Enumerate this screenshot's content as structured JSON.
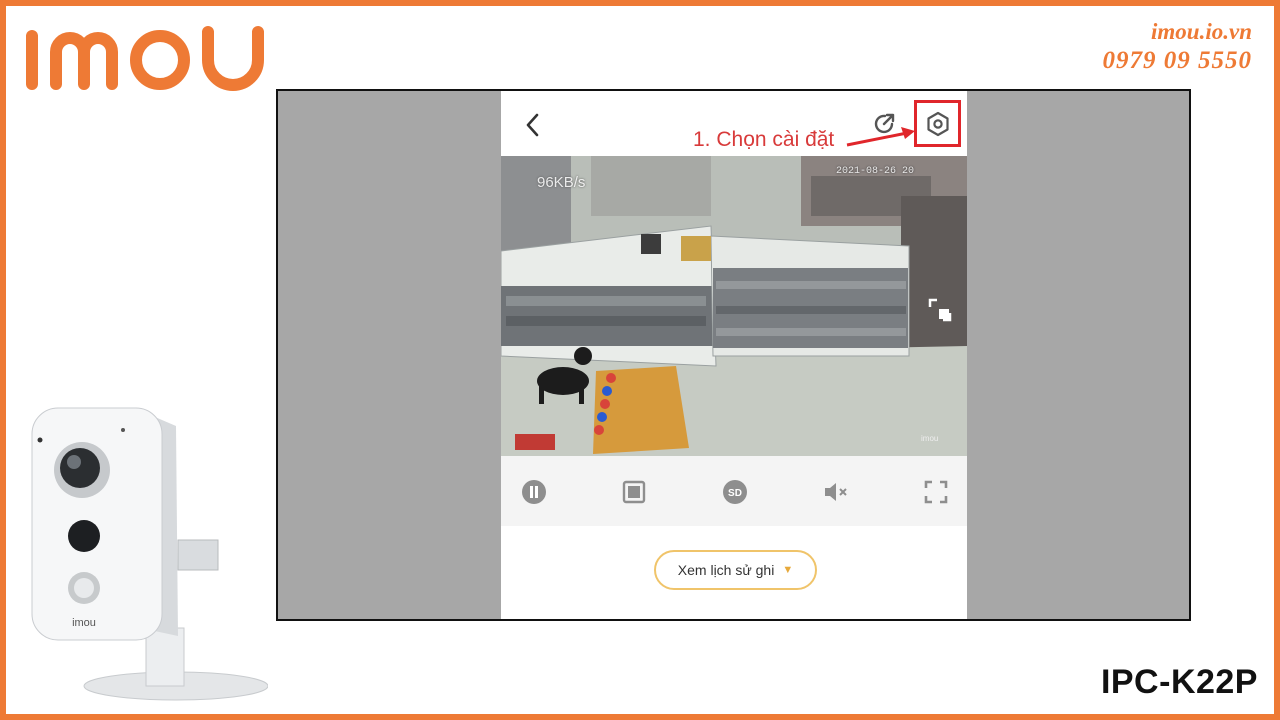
{
  "brand": {
    "logo_text": "imou",
    "accent_color": "#ee7a35"
  },
  "contact": {
    "website": "imou.io.vn",
    "phone": "0979 09 5550"
  },
  "app_screen": {
    "annotation": "1. Chọn cài đặt",
    "video": {
      "bitrate": "96KB/s",
      "timestamp": "2021-08-26 20"
    },
    "controls": [
      {
        "icon": "pause-icon"
      },
      {
        "icon": "multi-screen-icon"
      },
      {
        "icon": "sd-quality-icon",
        "label": "SD"
      },
      {
        "icon": "mute-icon"
      },
      {
        "icon": "fullscreen-icon"
      }
    ],
    "history_button": "Xem lịch sử ghi"
  },
  "product": {
    "model": "IPC-K22P",
    "camera_brand": "imou"
  }
}
